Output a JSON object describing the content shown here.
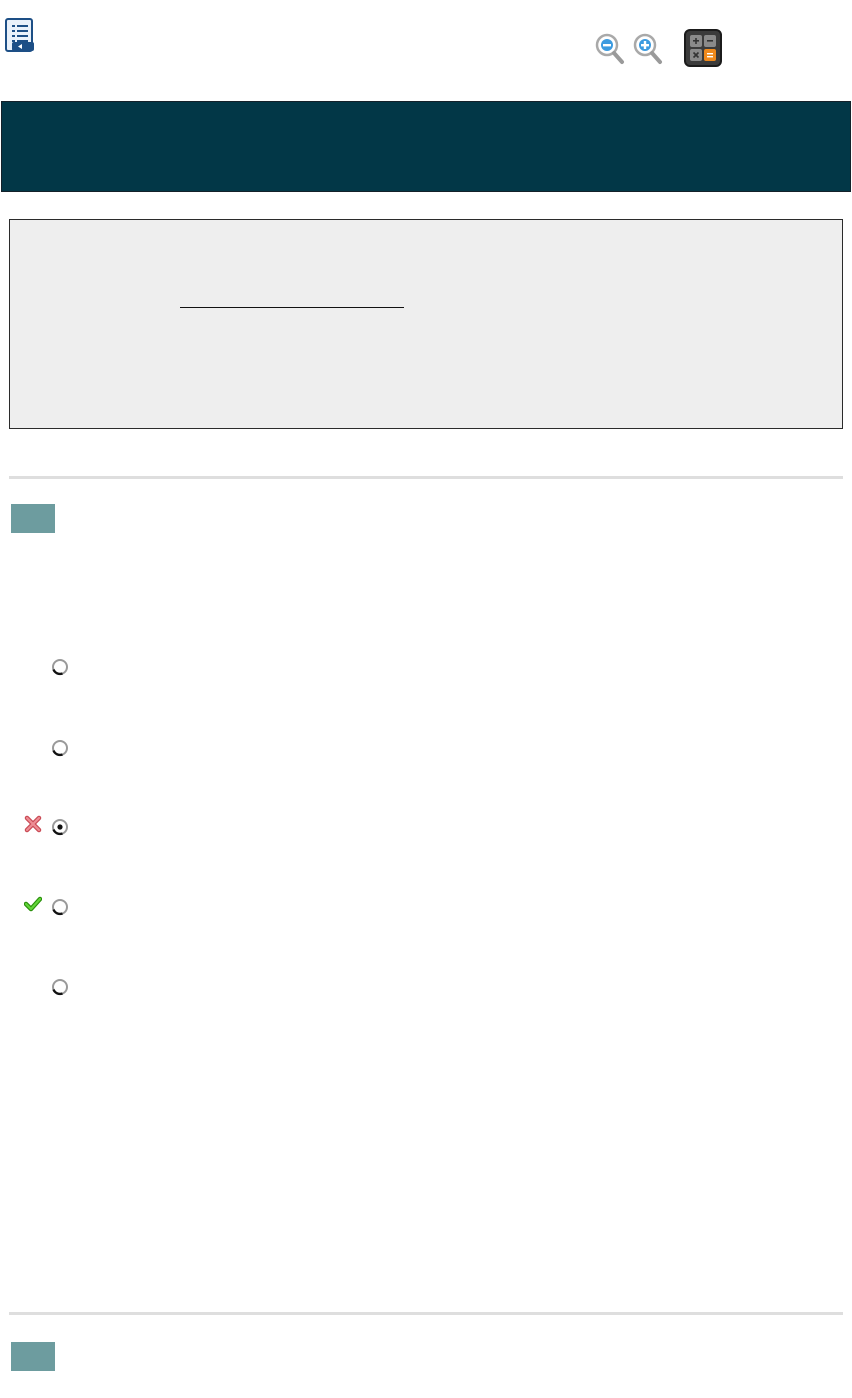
{
  "toolbar": {
    "icons": [
      "review-list-icon",
      "zoom-out-icon",
      "zoom-in-icon",
      "calculator-icon"
    ]
  },
  "question": {
    "choices": [
      {
        "id": "A",
        "selected": false,
        "mark": ""
      },
      {
        "id": "B",
        "selected": false,
        "mark": ""
      },
      {
        "id": "C",
        "selected": true,
        "mark": "incorrect"
      },
      {
        "id": "D",
        "selected": false,
        "mark": "correct"
      },
      {
        "id": "E",
        "selected": false,
        "mark": ""
      }
    ]
  },
  "colors": {
    "header": "#023747",
    "panel": "#eeeeee",
    "badge": "#6d9c9f",
    "divider": "#dedede",
    "incorrect": "#e0626a",
    "correct": "#35b313",
    "zoom_accent": "#3c9be0",
    "calc_orange": "#f08a1c"
  }
}
